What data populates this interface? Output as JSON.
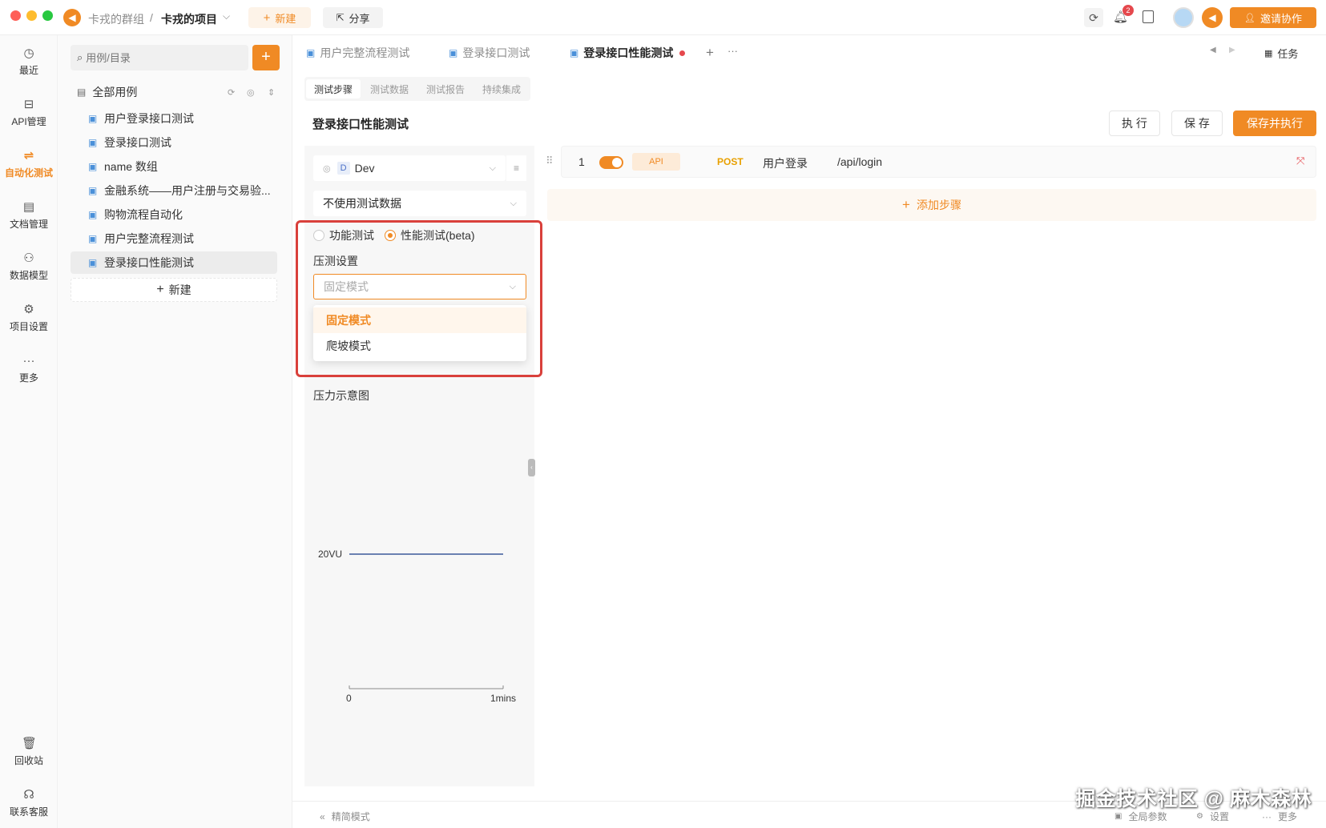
{
  "titlebar": {
    "group_name": "卡戎的群组",
    "separator": "/",
    "project_name": "卡戎的项目",
    "new_label": "新建",
    "share_label": "分享",
    "notification_count": "2",
    "invite_label": "邀请协作"
  },
  "leftnav": {
    "items": [
      {
        "label": "最近",
        "icon": "clock-icon"
      },
      {
        "label": "API管理",
        "icon": "api-icon"
      },
      {
        "label": "自动化测试",
        "icon": "automation-icon"
      },
      {
        "label": "文档管理",
        "icon": "document-icon"
      },
      {
        "label": "数据模型",
        "icon": "model-icon"
      },
      {
        "label": "项目设置",
        "icon": "settings-icon"
      },
      {
        "label": "更多",
        "icon": "more-icon"
      }
    ],
    "bottom": [
      {
        "label": "回收站",
        "icon": "trash-icon"
      },
      {
        "label": "联系客服",
        "icon": "headset-icon"
      }
    ]
  },
  "tree": {
    "search_placeholder": "用例/目录",
    "root_label": "全部用例",
    "items": [
      "用户登录接口测试",
      "登录接口测试",
      "name 数组",
      "金融系统——用户注册与交易验...",
      "购物流程自动化",
      "用户完整流程测试",
      "登录接口性能测试"
    ],
    "new_label": "新建"
  },
  "tabs": [
    {
      "label": "用户完整流程测试"
    },
    {
      "label": "登录接口测试"
    },
    {
      "label": "登录接口性能测试"
    }
  ],
  "tasks_label": "任务",
  "subtabs": [
    "测试步骤",
    "测试数据",
    "测试报告",
    "持续集成"
  ],
  "page_title": "登录接口性能测试",
  "actions": {
    "run": "执 行",
    "save": "保 存",
    "save_run": "保存并执行"
  },
  "config": {
    "env_badge": "D",
    "env_name": "Dev",
    "test_data": "不使用测试数据",
    "mode_functional": "功能测试",
    "mode_performance": "性能测试(beta)",
    "pressure_settings_label": "压测设置",
    "pressure_select_placeholder": "固定模式",
    "options": [
      "固定模式",
      "爬坡模式"
    ],
    "diagram_label": "压力示意图"
  },
  "chart_data": {
    "type": "line",
    "series": [
      {
        "values": [
          20,
          20
        ]
      }
    ],
    "x": [
      0,
      1
    ],
    "y_tick_label": "20VU",
    "x_tick_labels": [
      "0",
      "1mins"
    ],
    "line_color": "#3b5a9a"
  },
  "steps": [
    {
      "index": "1",
      "enabled": true,
      "type": "API",
      "method": "POST",
      "name": "用户登录",
      "path": "/api/login"
    }
  ],
  "add_step_label": "添加步骤",
  "footer": {
    "compact_mode": "精简模式",
    "global_params": "全局参数",
    "settings": "设置",
    "more": "更多"
  },
  "watermark": "掘金技术社区 @ 麻木森林",
  "colors": {
    "accent": "#f08a24",
    "danger": "#d9403b",
    "link": "#4a90d9"
  }
}
